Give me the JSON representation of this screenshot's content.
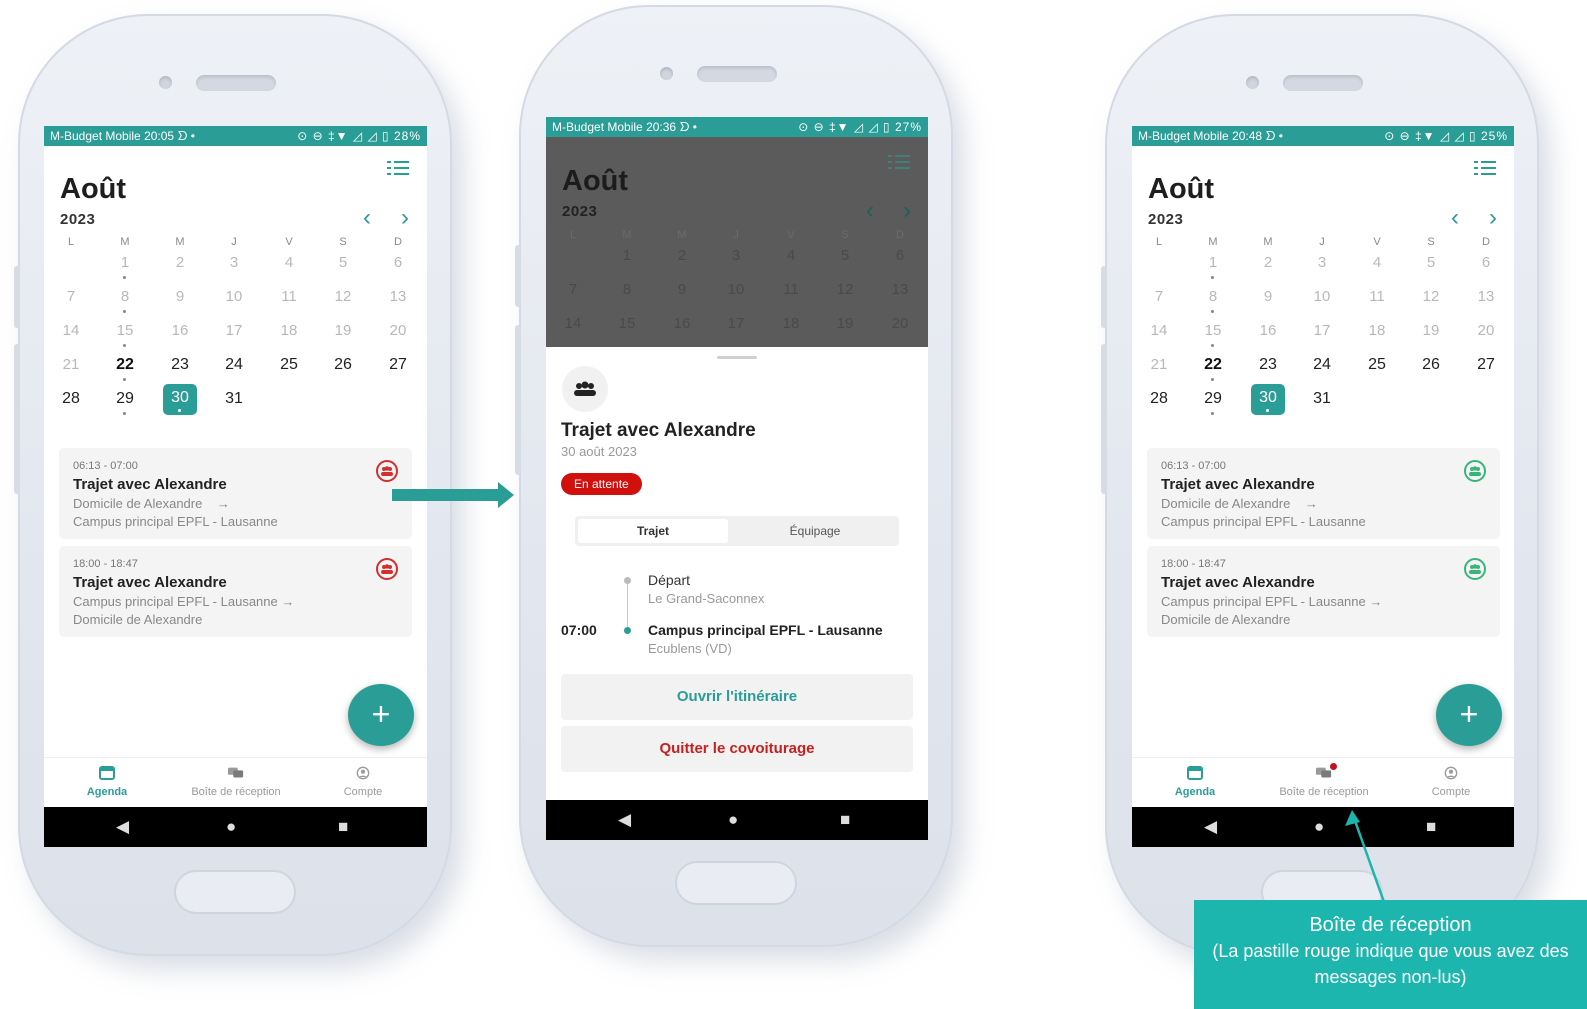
{
  "status": {
    "carrier": "M-Budget Mobile",
    "icons": "ᗤ •",
    "right_icons": "⊙ ⊖ ‡▼ ◿ ◿ ▯",
    "phones": [
      {
        "time": "20:05",
        "battery": "28%"
      },
      {
        "time": "20:36",
        "battery": "27%"
      },
      {
        "time": "20:48",
        "battery": "25%"
      }
    ]
  },
  "calendar": {
    "month": "Août",
    "year": "2023",
    "weekdays": [
      "L",
      "M",
      "M",
      "J",
      "V",
      "S",
      "D"
    ],
    "weeks": [
      [
        "",
        "1",
        "2",
        "3",
        "4",
        "5",
        "6"
      ],
      [
        "7",
        "8",
        "9",
        "10",
        "11",
        "12",
        "13"
      ],
      [
        "14",
        "15",
        "16",
        "17",
        "18",
        "19",
        "20"
      ],
      [
        "21",
        "22",
        "23",
        "24",
        "25",
        "26",
        "27"
      ],
      [
        "28",
        "29",
        "30",
        "31",
        "",
        "",
        ""
      ]
    ],
    "selected_day": "30",
    "prev_icon": "chevron-left-icon",
    "next_icon": "chevron-right-icon"
  },
  "events": [
    {
      "time": "06:13 - 07:00",
      "title": "Trajet avec Alexandre",
      "from": "Domicile de Alexandre",
      "arrow": "→",
      "to": "Campus principal EPFL - Lausanne"
    },
    {
      "time": "18:00 - 18:47",
      "title": "Trajet avec Alexandre",
      "from": "Campus principal EPFL - Lausanne",
      "arrow": "→",
      "to": "Domicile de Alexandre"
    }
  ],
  "fab_label": "+",
  "tabs": [
    {
      "label": "Agenda",
      "icon": "calendar-icon"
    },
    {
      "label": "Boîte de réception",
      "icon": "chat-icon"
    },
    {
      "label": "Compte",
      "icon": "user-circle-icon"
    }
  ],
  "sysnav": {
    "back": "◀",
    "home": "●",
    "recent": "■"
  },
  "sheet": {
    "title": "Trajet avec Alexandre",
    "date": "30 août 2023",
    "badge": "En attente",
    "segments": [
      "Trajet",
      "Équipage"
    ],
    "stops": [
      {
        "time": "",
        "name": "Départ",
        "place": "Le Grand-Saconnex"
      },
      {
        "time": "07:00",
        "name": "Campus principal EPFL - Lausanne",
        "place": "Ecublens (VD)"
      }
    ],
    "open_route": "Ouvrir l'itinéraire",
    "leave": "Quitter le covoiturage"
  },
  "callout": {
    "title": "Boîte de réception",
    "body": "(La pastille rouge indique que vous avez des messages non-lus)"
  },
  "colors": {
    "accent": "#2a9d96",
    "danger": "#d32f2f",
    "callout": "#1cb6ae",
    "success": "#3ab47a"
  }
}
